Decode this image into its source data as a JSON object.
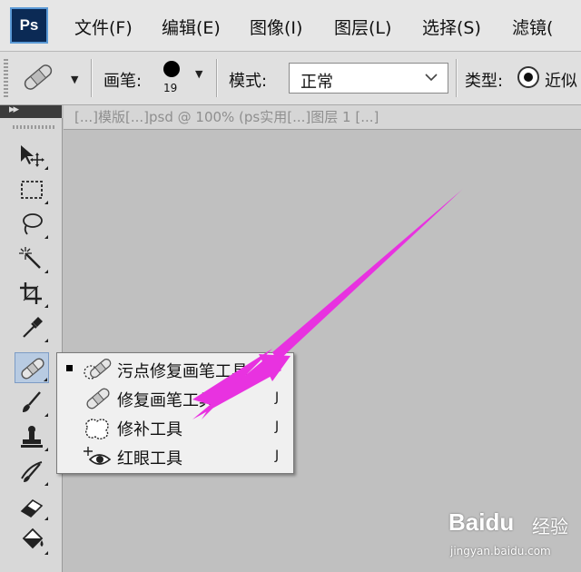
{
  "app": {
    "logo": "Ps"
  },
  "menu": [
    "文件(F)",
    "编辑(E)",
    "图像(I)",
    "图层(L)",
    "选择(S)",
    "滤镜("
  ],
  "options": {
    "brush_label": "画笔:",
    "brush_size": "19",
    "mode_label": "模式:",
    "mode_value": "正常",
    "type_label": "类型:",
    "type_option": "近似"
  },
  "document": {
    "tab_title": "[...]模版[...]psd @ 100% (ps实用[...]图层 1 [...]"
  },
  "flyout": {
    "items": [
      {
        "name": "污点修复画笔工具",
        "key": "J",
        "selected": true
      },
      {
        "name": "修复画笔工具",
        "key": "J",
        "selected": false
      },
      {
        "name": "修补工具",
        "key": "J",
        "selected": false
      },
      {
        "name": "红眼工具",
        "key": "J",
        "selected": false
      }
    ]
  },
  "toolbox": {
    "tools": [
      "move-tool",
      "marquee-tool",
      "lasso-tool",
      "magic-wand-tool",
      "crop-tool",
      "eyedropper-tool",
      "healing-brush-tool",
      "brush-tool",
      "clone-stamp-tool",
      "history-brush-tool",
      "eraser-tool",
      "paint-bucket-tool"
    ],
    "active": "healing-brush-tool"
  },
  "colors": {
    "arrow": "#e832e0",
    "active_tool": "#b8cbe2"
  },
  "watermark": {
    "logo": "Baidu",
    "cn": "经验",
    "url": "jingyan.baidu.com"
  }
}
